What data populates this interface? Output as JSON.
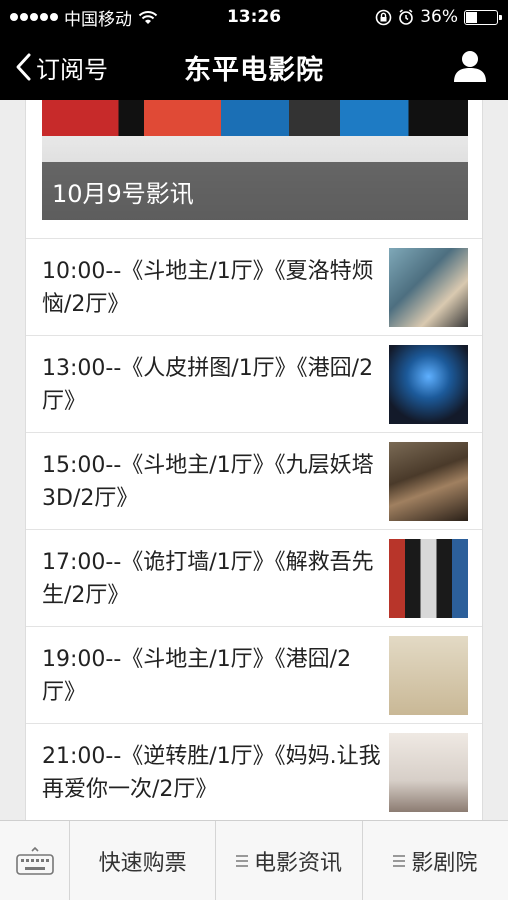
{
  "status_bar": {
    "carrier": "中国移动",
    "time": "13:26",
    "battery": "36%",
    "battery_level": 0.36
  },
  "nav": {
    "back_label": "订阅号",
    "title": "东平电影院"
  },
  "hero": {
    "caption": "10月9号影讯"
  },
  "schedule": [
    {
      "text": "10:00--《斗地主/1厅》《夏洛特烦恼/2厅》"
    },
    {
      "text": "13:00--《人皮拼图/1厅》《港囧/2厅》"
    },
    {
      "text": "15:00--《斗地主/1厅》《九层妖塔3D/2厅》"
    },
    {
      "text": "17:00--《诡打墙/1厅》《解救吾先生/2厅》"
    },
    {
      "text": "19:00--《斗地主/1厅》《港囧/2厅》"
    },
    {
      "text": "21:00--《逆转胜/1厅》《妈妈.让我再爱你一次/2厅》"
    }
  ],
  "tabs": {
    "quick_ticket": "快速购票",
    "movie_news": "电影资讯",
    "cinema": "影剧院"
  }
}
